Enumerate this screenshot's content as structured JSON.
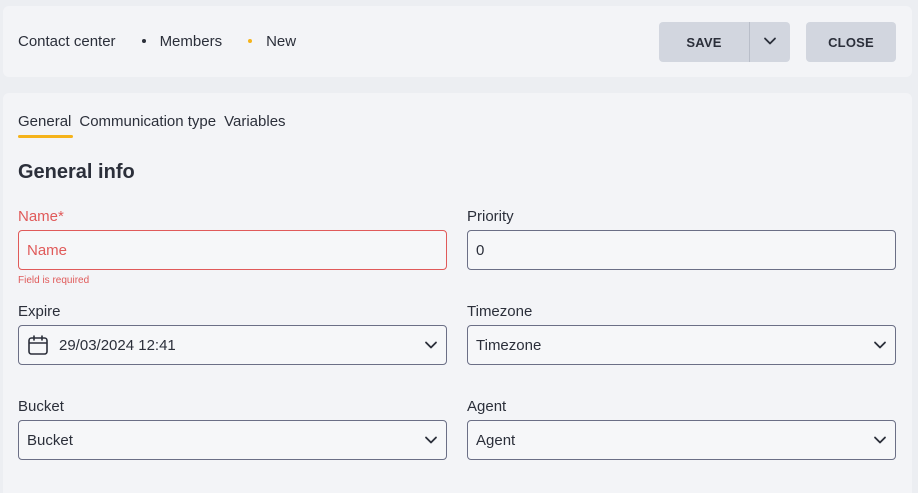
{
  "breadcrumb": {
    "items": [
      "Contact center",
      "Members",
      "New"
    ]
  },
  "header": {
    "save_label": "SAVE",
    "close_label": "CLOSE"
  },
  "tabs": [
    {
      "label": "General",
      "active": true
    },
    {
      "label": "Communication type",
      "active": false
    },
    {
      "label": "Variables",
      "active": false
    }
  ],
  "section_title": "General info",
  "form": {
    "name": {
      "label": "Name*",
      "placeholder": "Name",
      "value": "",
      "error": "Field is required"
    },
    "priority": {
      "label": "Priority",
      "value": "0"
    },
    "expire": {
      "label": "Expire",
      "value": "29/03/2024 12:41"
    },
    "timezone": {
      "label": "Timezone",
      "value": "Timezone"
    },
    "bucket": {
      "label": "Bucket",
      "value": "Bucket"
    },
    "agent": {
      "label": "Agent",
      "value": "Agent"
    }
  },
  "colors": {
    "accent": "#f5b31b",
    "error": "#e05a5a",
    "button_bg": "#d2d6df"
  },
  "icons": {
    "dropdown": "chevron-down-icon",
    "date": "calendar-icon"
  }
}
